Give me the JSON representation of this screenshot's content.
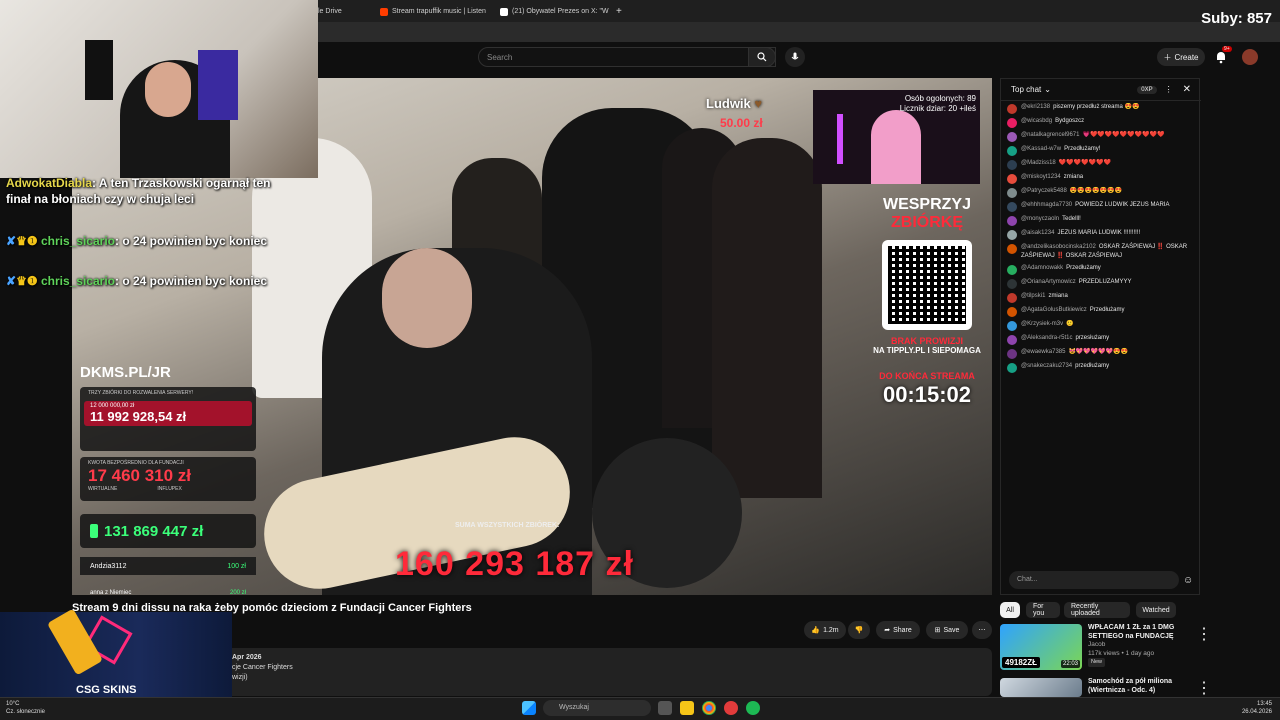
{
  "browser": {
    "tabs": [
      {
        "label": "le Drive",
        "color": "#4285f4"
      },
      {
        "label": "Stream trapuffik music | Listen",
        "color": "#ff3d00"
      },
      {
        "label": "(21) Obywatel Prezes on X: \"W",
        "color": "#ffffff"
      }
    ],
    "new_tab": "+"
  },
  "subs_counter": "Suby: 857",
  "youtube": {
    "search_placeholder": "Search",
    "create_label": "Create",
    "notif_badge": "9+"
  },
  "stream_chat_overlay": [
    {
      "user": "AdwokatDiabla",
      "text": ": A ten Trzaskowski ogarnął ten",
      "text2": "finał na błoniach czy w chuja leci"
    },
    {
      "user": "chris_sicario",
      "text": ": o 24 powinien byc koniec"
    },
    {
      "user": "chris_sicario",
      "text": ": o 24 powinien byc koniec"
    }
  ],
  "video_overlay": {
    "ludwik_name": "Ludwik",
    "ludwik_amount": "50.00 zł",
    "viewers_label": "Osób ogolonych: 89",
    "counter_label": "Licznik dziar: 20 +ileś",
    "support_title1": "WESPRZYJ",
    "support_title2": "ZBIÓRKĘ",
    "no_fee1": "BRAK PROWIZJI",
    "no_fee2": "NA TIPPLY.PL I SIEPOMAGA",
    "until_end": "DO KOŃCA STREAMA",
    "timer": "00:15:02",
    "site": "DKMS.PL/JR",
    "panel_header": "TRZY ZBIÓRKI DO ROZWALENIA SERWERY!",
    "goal": "12 000 000,00 zł",
    "amount1": "11 992 928,54 zł",
    "amount2_label": "KWOTA BEZPOŚREDNIO DLA FUNDACJI",
    "amount2": "17 460 310 zł",
    "virtual_label": "WIRTUALNE",
    "influ_label": "INFLUPEX",
    "amount3": "131 869 447 zł",
    "donor1": "Andzia3112",
    "donor1_amt": "100 zł",
    "donor2": "anna z Niemiec",
    "donor2_amt": "200 zł",
    "big_total": "160 293 187 zł",
    "all_label": "SUMA WSZYSTKICH ZBIÓREK:"
  },
  "chat": {
    "title": "Top chat",
    "xp": "0XP",
    "input_placeholder": "Chat...",
    "messages": [
      {
        "user": "@ekri2138",
        "text": "piszemy przedłuż streama 😍😍",
        "color": "#c0392b"
      },
      {
        "user": "@wicasbdg",
        "text": "Bydgoszcz",
        "color": "#e91e63"
      },
      {
        "user": "@natalkagrencel9671",
        "text": "💗❤️❤️❤️❤️❤️❤️❤️❤️❤️❤️",
        "color": "#9b59b6"
      },
      {
        "user": "@Kassad-w7w",
        "text": "Przedłużamy!",
        "color": "#16a085"
      },
      {
        "user": "@Madziss18",
        "text": "❤️❤️❤️❤️❤️❤️❤️",
        "color": "#2c3e50"
      },
      {
        "user": "@miskoyt1234",
        "text": "zmiana",
        "color": "#e74c3c"
      },
      {
        "user": "@Patryczek5488",
        "text": "😍😍😍😍😍😍😍",
        "color": "#7f8c8d"
      },
      {
        "user": "@ehhhmagda7730",
        "text": "POWIEDZ LUDWIK JEZUS MARIA",
        "color": "#34495e"
      },
      {
        "user": "@monyczaoln",
        "text": "Tedelll!",
        "color": "#8e44ad"
      },
      {
        "user": "@aisak1234",
        "text": "JEZUS MARIA LUDWIK !!!!!!!!!!",
        "color": "#95a5a6"
      },
      {
        "user": "@andzelikasobocinska2102",
        "text": "OSKAR ZAŚPIEWAJ ‼️ OSKAR ZAŚPIEWAJ ‼️ OSKAR ZAŚPIEWAJ",
        "color": "#d35400"
      },
      {
        "user": "@Adamnowakk",
        "text": "Przedłużamy",
        "color": "#27ae60"
      },
      {
        "user": "@OrianaArtymowicz",
        "text": "PRZEDLUZAMYYY",
        "color": "#2d3436"
      },
      {
        "user": "@tilpski1",
        "text": "zmiana",
        "color": "#c0392b"
      },
      {
        "user": "@AgataGolusButkiewicz",
        "text": "Przedłużamy",
        "color": "#d35400"
      },
      {
        "user": "@Krzysiek-m3v",
        "text": "🙂",
        "color": "#3498db"
      },
      {
        "user": "@Aleksandra-r5t1c",
        "text": "przesłużamy",
        "color": "#8e44ad"
      },
      {
        "user": "@ewaewka7385",
        "text": "😻💖💖💖💖💖😍😍",
        "color": "#6c3483"
      },
      {
        "user": "@snakeczaku2734",
        "text": "przedłużamy",
        "color": "#16a085"
      }
    ]
  },
  "video": {
    "title": "Stream 9 dni dissu na raka żeby pomóc dzieciom z Fundacji Cancer Fighters",
    "likes": "1.2m",
    "share": "Share",
    "save": "Save",
    "desc_date": "Apr 2026",
    "desc_line": "cje Cancer Fighters",
    "desc_line2": "wizji)"
  },
  "recommendations": {
    "chips": [
      "All",
      "For you",
      "Recently uploaded",
      "Watched"
    ],
    "items": [
      {
        "title": "WPŁACAM 1 ZŁ za 1 DMG SETTIEGO na FUNDACJĘ",
        "channel": "Jacob",
        "meta": "117k views • 1 day ago",
        "badge": "New",
        "duration": "22:03",
        "thumb_text": "49182ZŁ"
      },
      {
        "title": "Samochód za pół miliona (Wiertnicza - Odc. 4)",
        "channel": "",
        "meta": "",
        "badge": "",
        "duration": "",
        "thumb_text": ""
      }
    ]
  },
  "csg": {
    "label": "CSG SKINS"
  },
  "taskbar": {
    "weather_temp": "10°C",
    "weather_desc": "Cz. słonecznie",
    "search_label": "Wyszukaj",
    "time": "13:45",
    "date": "26.04.2026"
  }
}
